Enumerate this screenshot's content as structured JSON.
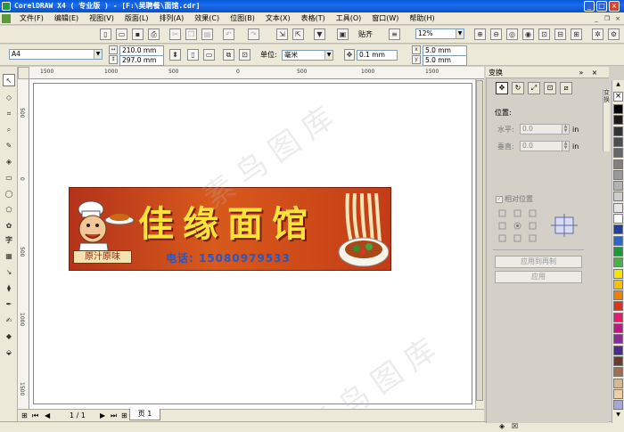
{
  "window": {
    "title": "CorelDRAW X4 ( 专业版 ) - [F:\\吴聘餐\\面馆.cdr]",
    "min": "_",
    "max": "□",
    "close": "×"
  },
  "menus": [
    "文件(F)",
    "编辑(E)",
    "视图(V)",
    "版面(L)",
    "排列(A)",
    "效果(C)",
    "位图(B)",
    "文本(X)",
    "表格(T)",
    "工具(O)",
    "窗口(W)",
    "帮助(H)"
  ],
  "toolbar": {
    "snap_label": "贴齐",
    "zoom": "12%"
  },
  "property_bar": {
    "page_size": "A4",
    "width": "210.0 mm",
    "height": "297.0 mm",
    "units_label": "单位:",
    "units": "毫米",
    "nudge": "0.1 mm",
    "dup_x": "5.0 mm",
    "dup_y": "5.0 mm"
  },
  "ruler": {
    "top_ticks": [
      "1500",
      "1000",
      "500",
      "0",
      "500",
      "1000",
      "1500"
    ],
    "left_ticks": [
      "500",
      "0",
      "500",
      "1000",
      "1500"
    ]
  },
  "banner": {
    "shop_name": "佳缘面馆",
    "phone": "电话: 15080979533",
    "flavor": "原汁原味"
  },
  "page_nav": {
    "counter": "1 / 1",
    "tab": "页 1"
  },
  "docker": {
    "title": "变换",
    "position_label": "位置:",
    "horizontal_label": "水平:",
    "horizontal_value": "0.0",
    "vertical_label": "垂直:",
    "vertical_value": "0.0",
    "unit": "in",
    "relative_label": "相对位置",
    "apply_dup": "应用到再制",
    "apply": "应用",
    "side_tab": "变换"
  },
  "watermark": "素 鸟 图 库",
  "palette": [
    "#000000",
    "#1a1a1a",
    "#333333",
    "#4d4d4d",
    "#666666",
    "#808080",
    "#999999",
    "#b3b3b3",
    "#cccccc",
    "#e6e6e6",
    "#ffffff",
    "#1f3fa0",
    "#2a67c8",
    "#1a9a3a",
    "#4bb04a",
    "#f7e400",
    "#fac000",
    "#f07e00",
    "#e0301e",
    "#e0206e",
    "#c01882",
    "#8a2c96",
    "#4a2a90",
    "#6a3a2a",
    "#a07048",
    "#d8b890",
    "#f0d0a0",
    "#a8a8d8"
  ]
}
